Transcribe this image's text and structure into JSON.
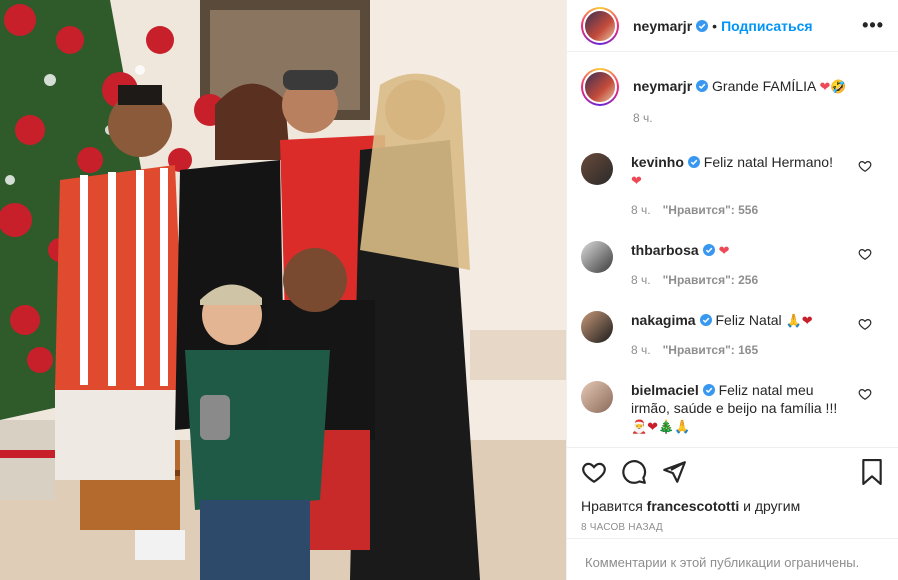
{
  "header": {
    "username": "neymarjr",
    "separator": "•",
    "follow_label": "Подписаться",
    "more_label": "•••"
  },
  "caption": {
    "username": "neymarjr",
    "text": "Grande FAMÍLIA",
    "emoji": "❤",
    "emoji2": "🤣",
    "time": "8 ч."
  },
  "comments": [
    {
      "username": "kevinho",
      "text": "Feliz natal Hermano!",
      "emoji": "❤",
      "time": "8 ч.",
      "likes": "\"Нравится\": 556"
    },
    {
      "username": "thbarbosa",
      "text": "",
      "emoji": "❤",
      "time": "8 ч.",
      "likes": "\"Нравится\": 256"
    },
    {
      "username": "nakagima",
      "text": "Feliz Natal",
      "emoji": "🙏❤",
      "time": "8 ч.",
      "likes": "\"Нравится\": 165"
    },
    {
      "username": "bielmaciel",
      "text": "Feliz natal meu irmão, saúde e beijo na família !!!",
      "emoji": "🎅❤🎄🙏",
      "time": "",
      "likes": ""
    }
  ],
  "actions": {
    "liked_prefix": "Нравится",
    "liked_user": "francescototti",
    "liked_suffix": "и другим",
    "time_ago": "8 ЧАСОВ НАЗАД"
  },
  "footer": {
    "comments_limited": "Комментарии к этой публикации ограничены."
  },
  "icons": {
    "verified": "verified-badge-icon",
    "like": "heart-icon",
    "comment": "comment-icon",
    "share": "share-icon",
    "save": "bookmark-icon"
  },
  "colors": {
    "accent": "#0095f6",
    "heart": "#ed4956",
    "muted": "#8e8e8e"
  }
}
